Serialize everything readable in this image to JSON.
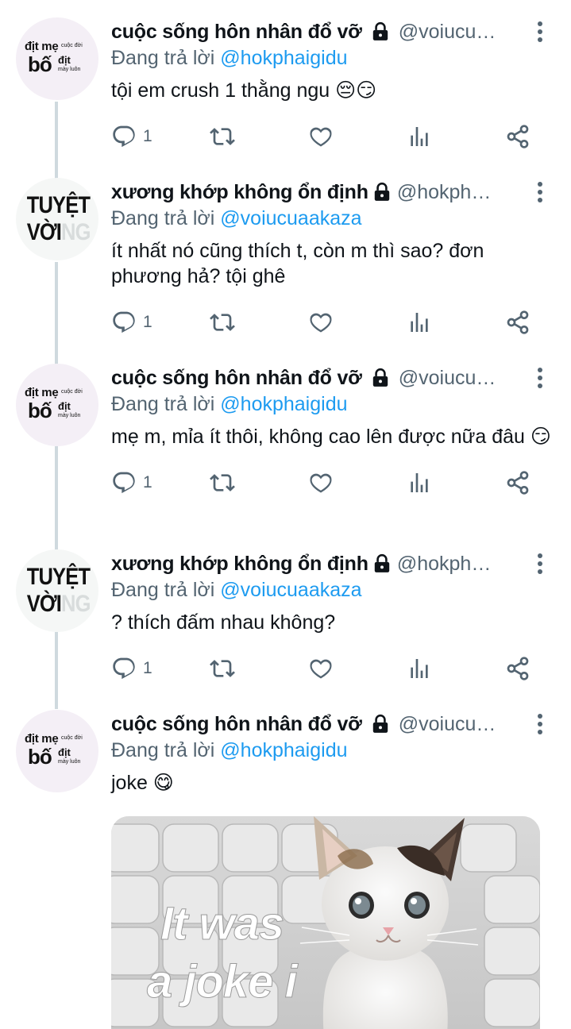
{
  "tweets": [
    {
      "avatar": "type-a",
      "display_name": "cuộc sống hôn nhân đổ vỡ",
      "handle": "@voiucu…",
      "reply_prefix": "Đang trả lời ",
      "reply_to": "@hokphaigidu",
      "text": "tội em crush 1 thằng ngu 😔😏",
      "reply_count": "1"
    },
    {
      "avatar": "type-b",
      "display_name": "xương khớp không ổn định",
      "handle": "@hokpha…",
      "reply_prefix": "Đang trả lời ",
      "reply_to": "@voiucuaakaza",
      "text": "ít nhất nó cũng thích t, còn m thì sao? đơn phương hả? tội ghê",
      "reply_count": "1"
    },
    {
      "avatar": "type-a",
      "display_name": "cuộc sống hôn nhân đổ vỡ",
      "handle": "@voiucu…",
      "reply_prefix": "Đang trả lời ",
      "reply_to": "@hokphaigidu",
      "text": "mẹ m, mỉa ít thôi, không cao lên được nữa đâu 😏",
      "reply_count": "1"
    },
    {
      "avatar": "type-b",
      "display_name": "xương khớp không ổn định",
      "handle": "@hokpha…",
      "reply_prefix": "Đang trả lời ",
      "reply_to": "@voiucuaakaza",
      "text": "? thích đấm nhau không?",
      "reply_count": "1"
    },
    {
      "avatar": "type-a",
      "display_name": "cuộc sống hôn nhân đổ vỡ",
      "handle": "@voiucu…",
      "reply_prefix": "Đang trả lời ",
      "reply_to": "@hokphaigidu",
      "text": "joke 😋",
      "reply_count": ""
    }
  ],
  "avatar_a": {
    "line1": "địt mẹ",
    "line1_small": "cuộc đời",
    "line2": "bố",
    "line2_small": "địt",
    "line3": "mày luôn"
  },
  "avatar_b": {
    "line1": "TUYỆT",
    "line2": "VỜI",
    "line2_faded": "NG"
  },
  "media": {
    "caption_line1": "It was",
    "caption_line2": "a joke i"
  },
  "colors": {
    "text": "#0f1419",
    "secondary": "#536471",
    "accent": "#1d9bf0",
    "thread_line": "#cfd9de"
  },
  "icons": {
    "reply": "reply-icon",
    "retweet": "retweet-icon",
    "like": "heart-icon",
    "views": "analytics-icon",
    "share": "share-icon",
    "more": "more-vertical-icon",
    "lock": "lock-icon"
  }
}
